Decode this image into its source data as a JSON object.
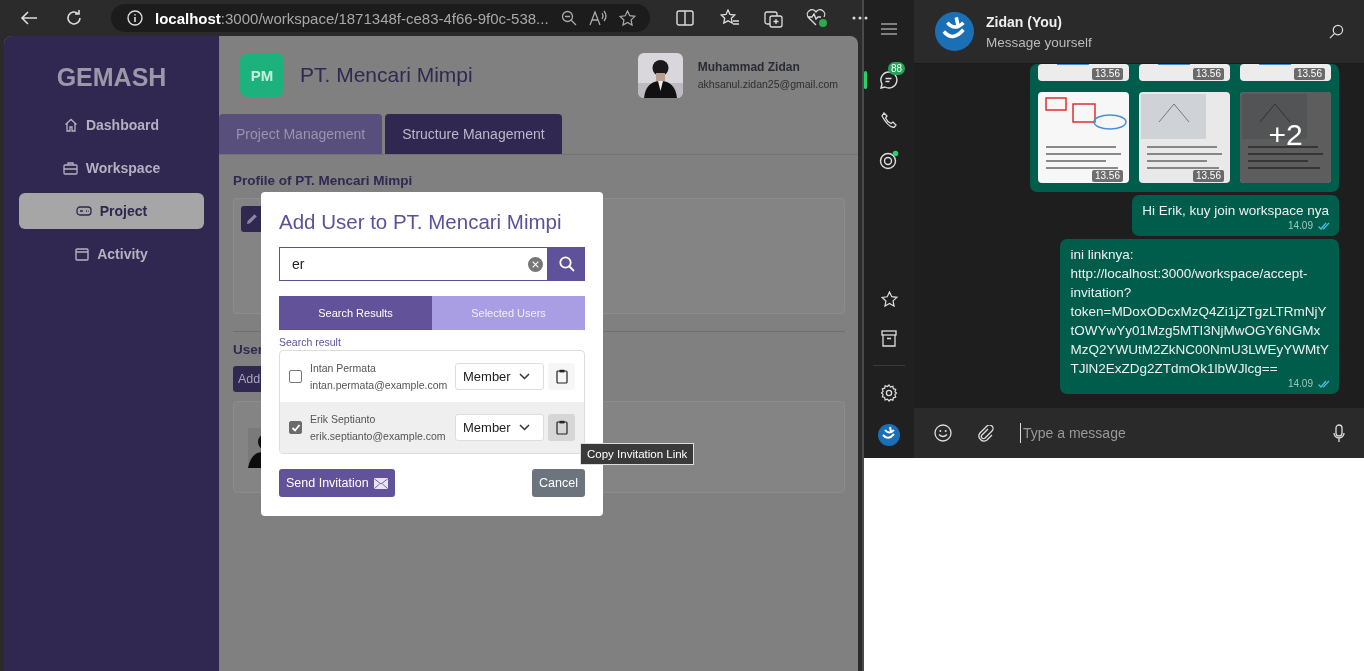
{
  "browser": {
    "url_host": "localhost",
    "url_path": ":3000/workspace/1871348f-ce83-4f66-9f0c-538..."
  },
  "sidebar": {
    "logo": "GEMASH",
    "items": [
      {
        "label": "Dashboard",
        "selected": false
      },
      {
        "label": "Workspace",
        "selected": false
      },
      {
        "label": "Project",
        "selected": true
      },
      {
        "label": "Activity",
        "selected": false
      }
    ]
  },
  "header": {
    "badge": "PM",
    "title": "PT. Mencari Mimpi",
    "user_name": "Muhammad Zidan",
    "user_email": "akhsanul.zidan25@gmail.com"
  },
  "tabs": [
    {
      "label": "Project Management",
      "selected": false
    },
    {
      "label": "Structure Management",
      "selected": true
    }
  ],
  "profile_heading": "Profile of PT. Mencari Mimpi",
  "users_heading": "User",
  "add_button": "Add",
  "modal": {
    "title": "Add User to PT. Mencari Mimpi",
    "search": {
      "value": "er"
    },
    "tabs": [
      {
        "label": "Search Results",
        "selected": true
      },
      {
        "label": "Selected Users",
        "selected": false
      }
    ],
    "result_label": "Search result",
    "users": [
      {
        "name": "Intan Permata",
        "email": "intan.permata@example.com",
        "role": "Member",
        "checked": false,
        "highlighted": false
      },
      {
        "name": "Erik Septianto",
        "email": "erik.septianto@example.com",
        "role": "Member",
        "checked": true,
        "highlighted": true
      }
    ],
    "tooltip": "Copy Invitation Link",
    "send_button": "Send Invitation",
    "cancel_button": "Cancel"
  },
  "whatsapp": {
    "chat_name": "Zidan (You)",
    "chat_subtitle": "Message yourself",
    "unread_badge": "88",
    "media_top_times": [
      "13.56",
      "13.56",
      "13.56"
    ],
    "media": [
      {
        "time": "13.56"
      },
      {
        "time": "13.56"
      },
      {
        "more": "+2"
      }
    ],
    "messages": [
      {
        "text": "Hi Erik, kuy join workspace nya",
        "time": "14.09"
      },
      {
        "text": "ini linknya:\nhttp://localhost:3000/workspace/accept-\ninvitation?\ntoken=MDoxODcxMzQ4Zi1jZTgzLTRmNjY\ntOWYwYy01Mzg5MTI3NjMwOGY6NGMx\nMzQ2YWUtM2ZkNC00NmU3LWEyYWMtY\nTJlN2ExZDg2ZTdmOk1lbWJlcg==",
        "time": "14.09"
      }
    ],
    "input": {
      "placeholder": "Type a message"
    }
  }
}
